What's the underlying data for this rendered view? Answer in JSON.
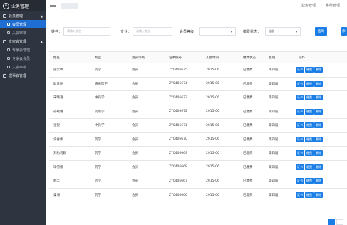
{
  "app": {
    "title": "业务管理"
  },
  "sidebar": {
    "groups": [
      {
        "label": "会员管理",
        "items": [
          {
            "label": "会员管理",
            "active": true
          },
          {
            "label": "入会审核",
            "active": false
          }
        ]
      },
      {
        "label": "专家会管理",
        "items": [
          {
            "label": "专家会管理",
            "active": false
          },
          {
            "label": "专家会会员",
            "active": false
          },
          {
            "label": "入会审核",
            "active": false
          }
        ]
      },
      {
        "label": "理事会管理",
        "items": []
      }
    ]
  },
  "topbar": {
    "links": [
      "业务管理",
      "系统管理"
    ]
  },
  "filter": {
    "name_label": "姓名：",
    "name_placeholder": "请输入姓名",
    "major_label": "专业：",
    "major_placeholder": "请输入专业",
    "level_label": "会员等级：",
    "level_value": "",
    "fee_label": "缴费状态：",
    "fee_value": "全部",
    "search_button": "查询",
    "right_button": "添"
  },
  "table": {
    "headers": [
      "姓名",
      "专业",
      "会员等级",
      "证书编号",
      "入会时间",
      "缴费状态",
      "会期",
      "操作"
    ],
    "rows": [
      [
        "施云峰",
        "药学",
        "会员",
        "ZY0406675",
        "2015-06",
        "已缴费",
        "第四届"
      ],
      [
        "耿爱民",
        "临床医学",
        "会员",
        "ZY0406674",
        "2015-06",
        "已缴费",
        "第四届"
      ],
      [
        "宋晓艳",
        "中药学",
        "会员",
        "ZY0406673",
        "2015-06",
        "已缴费",
        "第四届"
      ],
      [
        "孙载瑾",
        "药剂学",
        "会员",
        "ZY0406672",
        "2015-06",
        "已缴费",
        "第四届"
      ],
      [
        "张锐",
        "中药学",
        "会员",
        "ZY0406671",
        "2015-06",
        "已缴费",
        "第四届"
      ],
      [
        "许春伟",
        "药学",
        "会员",
        "ZY0406670",
        "2015-06",
        "已缴费",
        "第四届"
      ],
      [
        "刘约莉颖",
        "药学",
        "会员",
        "ZY0406669",
        "2015-06",
        "已缴费",
        "第四届"
      ],
      [
        "毕雪娟",
        "药学",
        "会员",
        "ZY0406668",
        "2015-06",
        "已缴费",
        "第四届"
      ],
      [
        "顾丰",
        "药学",
        "会员",
        "ZY0406667",
        "2015-06",
        "已缴费",
        "第四届"
      ],
      [
        "秦海",
        "药学",
        "会员",
        "ZY0406666",
        "2015-06",
        "已缴费",
        "第四届"
      ]
    ],
    "ops": [
      "证书",
      "缴费",
      "删除"
    ]
  }
}
